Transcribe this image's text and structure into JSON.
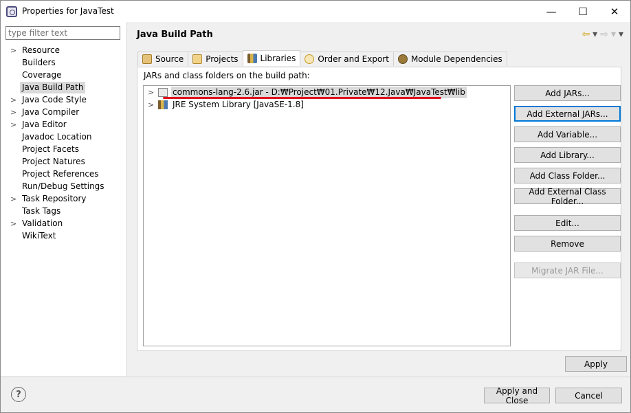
{
  "window": {
    "title": "Properties for JavaTest",
    "minimize_glyph": "—",
    "maximize_glyph": "☐",
    "close_glyph": "✕"
  },
  "filter": {
    "placeholder": "type filter text",
    "value": ""
  },
  "tree": {
    "items": [
      {
        "label": "Resource",
        "expandable": true
      },
      {
        "label": "Builders",
        "expandable": false
      },
      {
        "label": "Coverage",
        "expandable": false
      },
      {
        "label": "Java Build Path",
        "expandable": false,
        "selected": true
      },
      {
        "label": "Java Code Style",
        "expandable": true
      },
      {
        "label": "Java Compiler",
        "expandable": true
      },
      {
        "label": "Java Editor",
        "expandable": true
      },
      {
        "label": "Javadoc Location",
        "expandable": false
      },
      {
        "label": "Project Facets",
        "expandable": false
      },
      {
        "label": "Project Natures",
        "expandable": false
      },
      {
        "label": "Project References",
        "expandable": false
      },
      {
        "label": "Run/Debug Settings",
        "expandable": false
      },
      {
        "label": "Task Repository",
        "expandable": true
      },
      {
        "label": "Task Tags",
        "expandable": false
      },
      {
        "label": "Validation",
        "expandable": true
      },
      {
        "label": "WikiText",
        "expandable": false
      }
    ]
  },
  "page": {
    "title": "Java Build Path",
    "back_glyph": "⇦",
    "forward_glyph": "⇨",
    "menu_glyph": "▾"
  },
  "tabs": [
    {
      "label": "Source",
      "icon": "source-folder-icon",
      "active": false
    },
    {
      "label": "Projects",
      "icon": "projects-icon",
      "active": false
    },
    {
      "label": "Libraries",
      "icon": "libraries-icon",
      "active": true
    },
    {
      "label": "Order and Export",
      "icon": "order-export-icon",
      "active": false
    },
    {
      "label": "Module Dependencies",
      "icon": "module-dependencies-icon",
      "active": false
    }
  ],
  "libraries": {
    "subheading": "JARs and class folders on the build path:",
    "entries": [
      {
        "label": "commons-lang-2.6.jar - D:₩Project₩01.Private₩12.Java₩JavaTest₩lib",
        "icon": "jar-icon",
        "selected": true
      },
      {
        "label": "JRE System Library [JavaSE-1.8]",
        "icon": "library-icon",
        "selected": false
      }
    ],
    "buttons": {
      "add_jars": "Add JARs...",
      "add_external_jars": "Add External JARs...",
      "add_variable": "Add Variable...",
      "add_library": "Add Library...",
      "add_class_folder": "Add Class Folder...",
      "add_external_class_folder": "Add External Class Folder...",
      "edit": "Edit...",
      "remove": "Remove",
      "migrate_jar": "Migrate JAR File..."
    }
  },
  "actions": {
    "apply": "Apply",
    "apply_and_close": "Apply and Close",
    "cancel": "Cancel",
    "help_glyph": "?"
  },
  "colors": {
    "selection": "#d9d9d9",
    "focus_border": "#0078d7",
    "annotation_red": "#e0141e"
  }
}
